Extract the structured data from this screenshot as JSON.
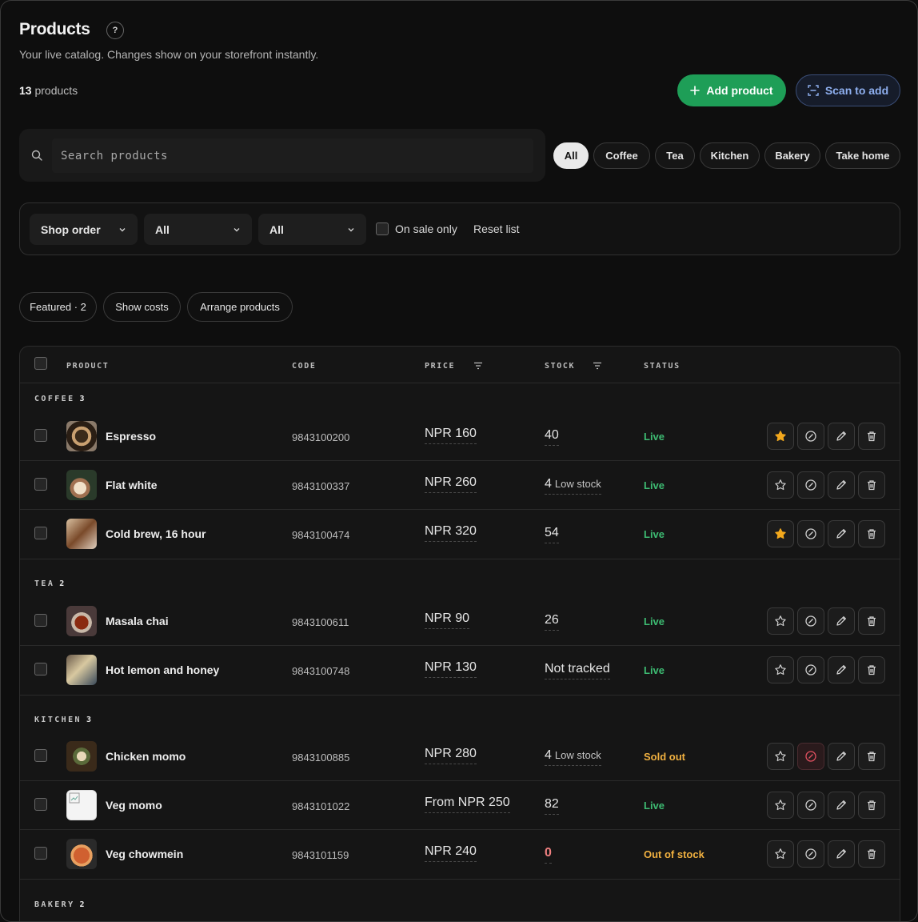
{
  "header": {
    "title": "Products",
    "help_glyph": "?",
    "subtitle": "Your live catalog. Changes show on your storefront instantly.",
    "count_number": "13",
    "count_suffix": " products",
    "add_label": "Add product",
    "scan_label": "Scan to add"
  },
  "search": {
    "placeholder": "Search products"
  },
  "chips": [
    "All",
    "Coffee",
    "Tea",
    "Kitchen",
    "Bakery",
    "Take home"
  ],
  "filters": {
    "sort_value": "Shop order",
    "filter1_value": "All",
    "filter2_value": "All",
    "on_sale_label": "On sale only",
    "reset_label": "Reset list"
  },
  "pills": {
    "featured": "Featured · 2",
    "costs": "Show costs",
    "arrange": "Arrange products"
  },
  "table": {
    "columns": {
      "product": "PRODUCT",
      "code": "CODE",
      "price": "PRICE",
      "stock": "STOCK",
      "status": "STATUS"
    },
    "groups": [
      {
        "name": "COFFEE",
        "count": "3"
      },
      {
        "name": "TEA",
        "count": "2"
      },
      {
        "name": "KITCHEN",
        "count": "3"
      },
      {
        "name": "BAKERY",
        "count": "2"
      }
    ],
    "rows": [
      {
        "name": "Espresso",
        "code": "9843100200",
        "price": "NPR 160",
        "stock": "40",
        "stock_note": "",
        "status": "Live",
        "featured": true
      },
      {
        "name": "Flat white",
        "code": "9843100337",
        "price": "NPR 260",
        "stock": "4",
        "stock_note": "Low stock",
        "status": "Live",
        "featured": false
      },
      {
        "name": "Cold brew, 16 hour",
        "code": "9843100474",
        "price": "NPR 320",
        "stock": "54",
        "stock_note": "",
        "status": "Live",
        "featured": true
      },
      {
        "name": "Masala chai",
        "code": "9843100611",
        "price": "NPR 90",
        "stock": "26",
        "stock_note": "",
        "status": "Live",
        "featured": false
      },
      {
        "name": "Hot lemon and honey",
        "code": "9843100748",
        "price": "NPR 130",
        "stock": "Not tracked",
        "stock_note": "",
        "status": "Live",
        "featured": false
      },
      {
        "name": "Chicken momo",
        "code": "9843100885",
        "price": "NPR 280",
        "stock": "4",
        "stock_note": "Low stock",
        "status": "Sold out",
        "featured": false
      },
      {
        "name": "Veg momo",
        "code": "9843101022",
        "price": "From NPR 250",
        "stock": "82",
        "stock_note": "",
        "status": "Live",
        "featured": false
      },
      {
        "name": "Veg chowmein",
        "code": "9843101159",
        "price": "NPR 240",
        "stock": "0",
        "stock_note": "",
        "status": "Out of stock",
        "featured": false
      }
    ]
  },
  "colors": {
    "accent_green": "#1e9e57",
    "scan_blue": "#8fb0f0",
    "live": "#3dbb72",
    "warning": "#f0b040",
    "star": "#f2a81d",
    "zero_stock": "#f08080"
  }
}
